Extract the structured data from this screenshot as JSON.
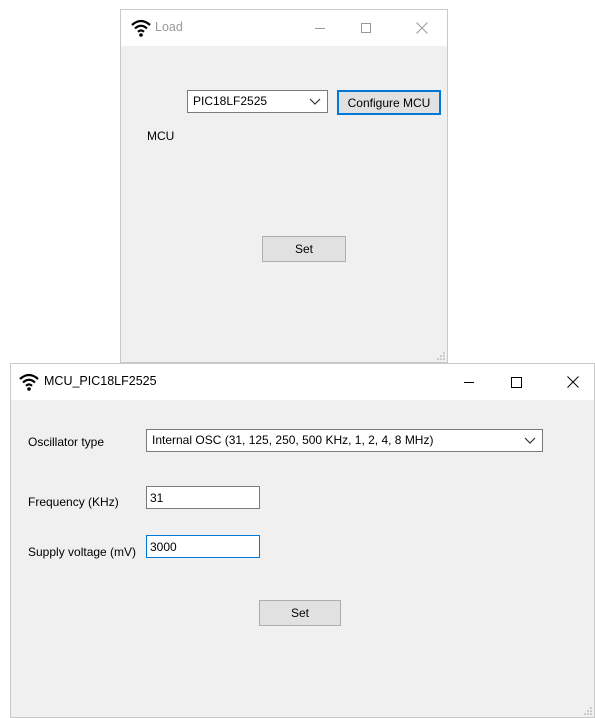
{
  "load_window": {
    "title": "Load",
    "mcu_label": "MCU",
    "mcu_selected": "PIC18LF2525",
    "configure_button": "Configure MCU",
    "set_button": "Set"
  },
  "mcu_window": {
    "title": "MCU_PIC18LF2525",
    "oscillator_label": "Oscillator type",
    "oscillator_selected": "Internal OSC (31, 125, 250, 500 KHz, 1, 2, 4, 8 MHz)",
    "frequency_label": "Frequency (KHz)",
    "frequency_value": "31",
    "voltage_label": "Supply voltage (mV)",
    "voltage_value": "3000",
    "set_button": "Set"
  },
  "icons": {
    "app": "wifi-icon",
    "minimize": "minimize-icon",
    "maximize": "maximize-icon",
    "close": "close-icon",
    "dropdown": "chevron-down-icon",
    "grip": "resize-grip-icon"
  }
}
